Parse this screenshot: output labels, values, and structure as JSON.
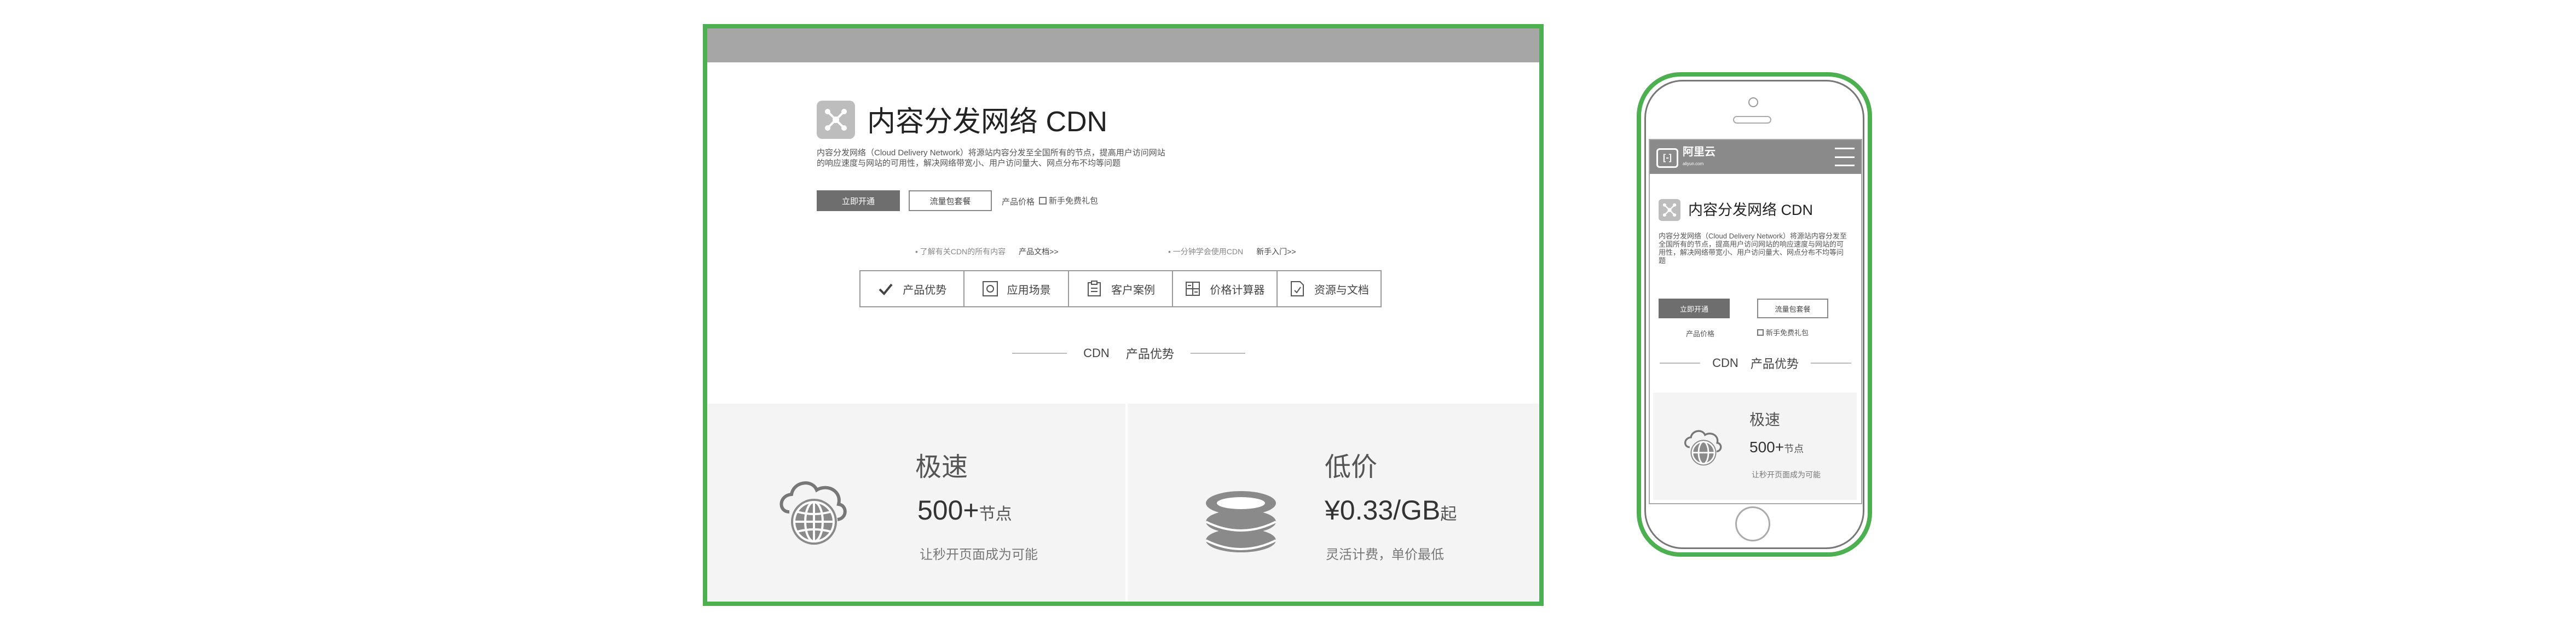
{
  "desktop": {
    "hero": {
      "title": "内容分发网络 CDN",
      "description": "内容分发网络（Cloud Delivery Network）将源站内容分发至全国所有的节点，提高用户访问网站的响应速度与网站的可用性，解决网络带宽小、用户访问量大、网点分布不均等问题"
    },
    "buttons": {
      "activate": "立即开通",
      "traffic_pack": "流量包套餐",
      "pricing": "产品价格",
      "gift": "新手免费礼包"
    },
    "hints": [
      {
        "text": "了解有关CDN的所有内容",
        "link": "产品文档>>"
      },
      {
        "text": "一分钟学会使用CDN",
        "link": "新手入门>>"
      }
    ],
    "tabs": [
      {
        "label": "产品优势",
        "icon": "check-icon"
      },
      {
        "label": "应用场景",
        "icon": "scene-icon"
      },
      {
        "label": "客户案例",
        "icon": "clipboard-icon"
      },
      {
        "label": "价格计算器",
        "icon": "calculator-icon"
      },
      {
        "label": "资源与文档",
        "icon": "document-icon"
      }
    ],
    "section": {
      "left": "CDN",
      "right": "产品优势"
    },
    "features": [
      {
        "title": "极速",
        "stat": "500+",
        "unit": "节点",
        "desc": "让秒开页面成为可能",
        "icon": "cloud-globe-icon"
      },
      {
        "title": "低价",
        "stat": "¥0.33/GB",
        "unit": "起",
        "desc": "灵活计费，单价最低",
        "icon": "coin-stack-icon"
      }
    ]
  },
  "mobile": {
    "logo": {
      "name": "阿里云",
      "sub": "aliyun.com"
    },
    "hero": {
      "title": "内容分发网络 CDN",
      "description": "内容分发网络（Cloud Delivery Network）将源站内容分发至全国所有的节点，提高用户访问网站的响应速度与网站的可用性，解决网络带宽小、用户访问量大、网点分布不均等问题"
    },
    "buttons": {
      "activate": "立即开通",
      "traffic_pack": "流量包套餐",
      "pricing": "产品价格",
      "gift": "新手免费礼包"
    },
    "section": {
      "left": "CDN",
      "right": "产品优势"
    },
    "feature": {
      "title": "极速",
      "stat": "500+",
      "unit": "节点",
      "desc": "让秒开页面成为可能"
    }
  },
  "colors": {
    "frame": "#4caf50",
    "primary_button": "#6e6e6e",
    "feature_bg": "#f4f4f4"
  }
}
